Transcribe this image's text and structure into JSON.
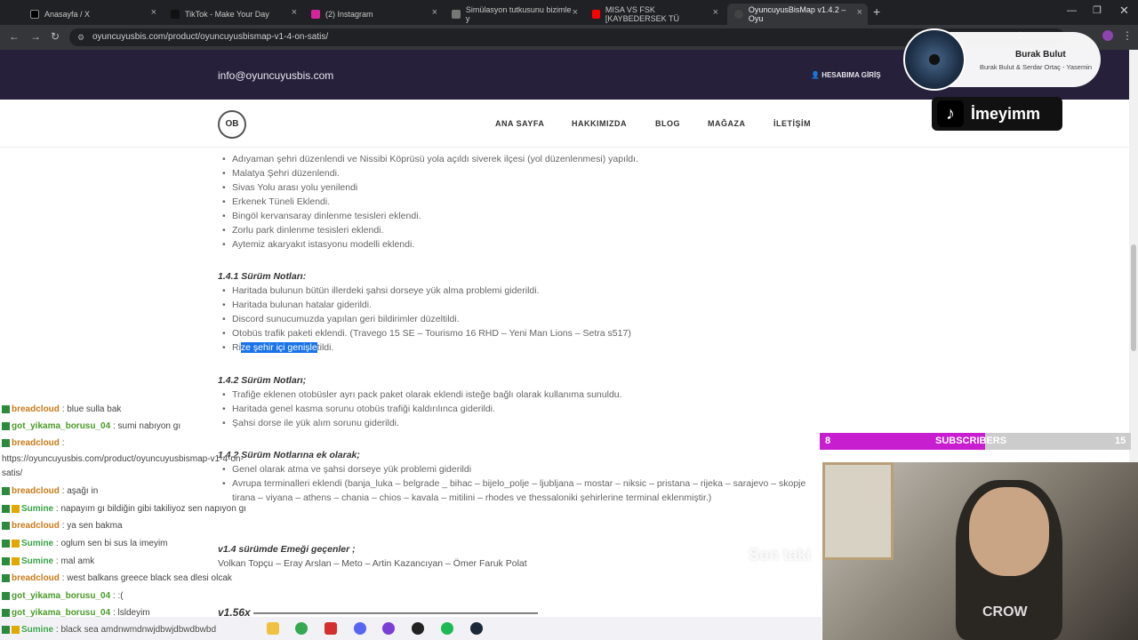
{
  "tabs": [
    {
      "label": "Anasayfa / X"
    },
    {
      "label": "TikTok - Make Your Day"
    },
    {
      "label": "(2) Instagram"
    },
    {
      "label": "Simülasyon tutkusunu bizimle y"
    },
    {
      "label": "MISA VS FSK [KAYBEDERSEK TÜ"
    },
    {
      "label": "OyuncuyusBisMap v1.4.2 – Oyu"
    }
  ],
  "url": "oyuncuyusbis.com/product/oyuncuyusbismap-v1-4-on-satis/",
  "site": {
    "email": "info@oyuncuyusbis.com",
    "account": "HESABIMA GİRİŞ",
    "logo": "OB",
    "menu": [
      "ANA SAYFA",
      "HAKKIMIZDA",
      "BLOG",
      "MAĞAZA",
      "İLETİŞİM"
    ]
  },
  "content": {
    "list_a": [
      "Adıyaman şehri düzenlendi ve Nissibi Köprüsü yola açıldı siverek ilçesi (yol düzenlenmesi) yapıldı.",
      "Malatya Şehri düzenlendi.",
      "Sivas Yolu arası yolu yenilendi",
      "Erkenek Tüneli Eklendi.",
      "Bingöl kervansaray dinlenme tesisleri eklendi.",
      "Zorlu park dinlenme tesisleri eklendi.",
      "Aytemiz akaryakıt istasyonu modelli eklendi."
    ],
    "h141": "1.4.1 Sürüm Notları:",
    "list_b": [
      "Haritada bulunun bütün illerdeki şahsi dorseye yük alma problemi giderildi.",
      "Haritada bulunan hatalar giderildi.",
      "Discord sunucumuzda yapılan geri bildirimler düzeltildi.",
      "Otobüs trafik paketi eklendi. (Travego 15 SE – Tourismo 16 RHD – Yeni Man Lions – Setra s517)"
    ],
    "rize_pre": "Ri",
    "rize_hl": "ze şehir içi genişle",
    "rize_post": "tildi.",
    "h142": "1.4.2 Sürüm Notları;",
    "list_c": [
      "Trafiğe eklenen otobüsler ayrı pack paket olarak eklendi isteğe bağlı olarak kullanıma sunuldu.",
      "Haritada genel kasma sorunu otobüs trafiği kaldırılınca giderildi.",
      "Şahsi dorse ile yük alım sorunu giderildi."
    ],
    "h142b": "1.4.2 Sürüm Notlarına ek olarak;",
    "list_d": [
      "Genel olarak atma ve şahsi dorseye yük problemi giderildi",
      "Avrupa terminalleri eklendi (banja_luka – belgrade _ bihac – bijelo_polje – ljubljana – mostar – niksic – pristana – rijeka – sarajevo – skopje",
      "tirana – viyana – athens – chania – chios – kavala – mitilini – rhodes ve thessaloniki şehirlerine terminal eklenmiştir.)"
    ],
    "h14": "v1.4 sürümde Emeği geçenler ;",
    "credits": "Volkan Topçu – Eray Arslan – Meto – Artin Kazancıyan – Ömer Faruk Polat",
    "h156": "v1.56x ——————————————————————————————"
  },
  "chat": [
    {
      "user": "breadcloud",
      "msg": ": blue sulla bak"
    },
    {
      "user": "got_yikama_borusu_04",
      "msg": ": sumi nabıyon gı"
    },
    {
      "user": "breadcloud",
      "msg": ":"
    },
    {
      "user": "",
      "msg": "https://oyuncuyusbis.com/product/oyuncuyusbismap-v1-4-on-"
    },
    {
      "user": "",
      "msg": "satis/"
    },
    {
      "user": "breadcloud",
      "msg": ": aşağı in"
    },
    {
      "user": "Sumine",
      "msg": ": napayım gı bildiğin gibi takiliyoz sen napıyon gı"
    },
    {
      "user": "breadcloud",
      "msg": ": ya sen bakma"
    },
    {
      "user": "Sumine",
      "msg": ": oglum sen bi sus la imeyim"
    },
    {
      "user": "Sumine",
      "msg": ": mal amk"
    },
    {
      "user": "breadcloud",
      "msg": ": west balkans greece black sea dlesi olcak"
    },
    {
      "user": "got_yikama_borusu_04",
      "msg": ": :("
    },
    {
      "user": "got_yikama_borusu_04",
      "msg": ": lsldeyim"
    },
    {
      "user": "Sumine",
      "msg": ": black sea amdnwmdnwjdbwjdbwdbwbd"
    }
  ],
  "music": {
    "title": "Burak Bulut",
    "artist": "Burak Bulut & Serdar Ortaç - Yasemin"
  },
  "tiktok": {
    "handle": "İmeyimm"
  },
  "subs": {
    "current": "8",
    "label": "SUBSCRIBERS",
    "goal": "15",
    "progress": 0.53
  },
  "webcam": {
    "overlay_text": "Son taki"
  }
}
